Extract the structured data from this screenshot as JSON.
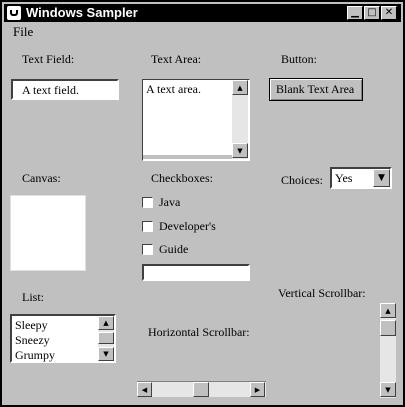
{
  "window": {
    "title": "Windows Sampler",
    "minimize_glyph": "▁",
    "maximize_glyph": "□",
    "close_glyph": "✕"
  },
  "menu": {
    "file_label": "File"
  },
  "text_field": {
    "label": "Text Field:",
    "value": "A text field."
  },
  "text_area": {
    "label": "Text Area:",
    "value": "A text area."
  },
  "button": {
    "label": "Button:",
    "text": "Blank Text Area"
  },
  "canvas": {
    "label": "Canvas:"
  },
  "checkboxes": {
    "label": "Checkboxes:",
    "items": [
      {
        "label": "Java",
        "checked": false
      },
      {
        "label": "Developer's",
        "checked": false
      },
      {
        "label": "Guide",
        "checked": false
      }
    ],
    "text_value": ""
  },
  "choices": {
    "label": "Choices:",
    "selected": "Yes"
  },
  "list": {
    "label": "List:",
    "items": [
      "Sleepy",
      "Sneezy",
      "Grumpy"
    ]
  },
  "horizontal_scrollbar": {
    "label": "Horizontal Scrollbar:"
  },
  "vertical_scrollbar": {
    "label": "Vertical Scrollbar:"
  },
  "icons": {
    "up": "▲",
    "down": "▼",
    "left": "◀",
    "right": "▶",
    "dropdown": "▼"
  }
}
